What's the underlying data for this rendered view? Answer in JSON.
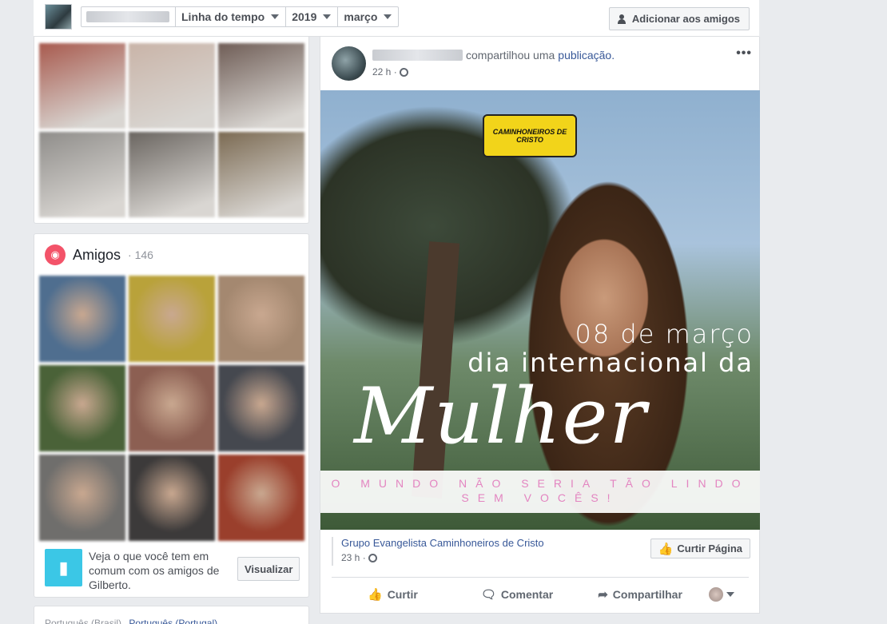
{
  "topbar": {
    "timeline_label": "Linha do tempo",
    "year_label": "2019",
    "month_label": "março",
    "add_friend_label": "Adicionar aos amigos"
  },
  "photos": {
    "tiles": [
      "#a85a4e",
      "#c9b4a8",
      "#6f5d56",
      "#8f8d8a",
      "#6a6560",
      "#7b6a52"
    ]
  },
  "friends": {
    "title": "Amigos",
    "count": "· 146",
    "tiles": [
      "#4f6e8f",
      "#b9a23a",
      "#a48870",
      "#4a6238",
      "#8c5f52",
      "#45484f",
      "#6f6e6c",
      "#3c3a3a",
      "#9a3f2c"
    ],
    "mutual_text": "Veja o que você tem em comum com os amigos de Gilberto.",
    "visualize_label": "Visualizar"
  },
  "language": {
    "current": "Português (Brasil)",
    "alternative": "Português (Portugal)"
  },
  "post": {
    "action_text": "compartilhou uma",
    "action_link": "publicação.",
    "time": "22 h ·",
    "more_icon": "•••",
    "image": {
      "logo_text": "CAMINHONEIROS DE CRISTO",
      "date_line": "08 de março",
      "dia_line": "dia internacional da",
      "mulher": "Mulher",
      "banner_line1": "O MUNDO NÃO SERIA TÃO LINDO",
      "banner_line2": "SEM VOCÊS!"
    },
    "shared": {
      "name": "Grupo Evangelista Caminhoneiros de Cristo",
      "time": "23 h ·",
      "like_page_label": "Curtir Página"
    },
    "actions": {
      "like": "Curtir",
      "comment": "Comentar",
      "share": "Compartilhar"
    }
  },
  "colors": {
    "link": "#385898",
    "friends_icon": "#f35369",
    "mutual_icon": "#3bc7e6",
    "banner_text": "#e385c1"
  }
}
